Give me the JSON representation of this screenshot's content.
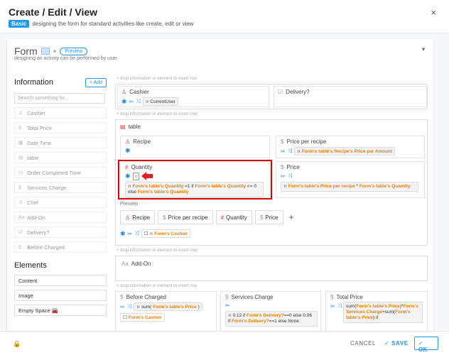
{
  "dialog": {
    "title": "Create / Edit / View",
    "badge": "Basic",
    "subtitle": "designing the form for standard activities like create, edit or view",
    "close_glyph": "×"
  },
  "form": {
    "title": "Form",
    "chip_close": "×",
    "preview_label": "Preview",
    "description": "designing an activity can be performed by user."
  },
  "sidebar": {
    "info_heading": "Information",
    "add_label": "+ Add",
    "search_placeholder": "Search something for...",
    "info_items": [
      {
        "icon": "user-icon",
        "glyph": "♙",
        "label": "Cashier"
      },
      {
        "icon": "dollar-icon",
        "glyph": "$",
        "label": "Total Price"
      },
      {
        "icon": "calendar-icon",
        "glyph": "▦",
        "label": "Date Time"
      },
      {
        "icon": "table-icon",
        "glyph": "▤",
        "label": "table"
      },
      {
        "icon": "clock-icon",
        "glyph": "◷",
        "label": "Order Completed Time"
      },
      {
        "icon": "dollar-icon",
        "glyph": "$",
        "label": "Services Charge"
      },
      {
        "icon": "user-icon",
        "glyph": "♙",
        "label": "Chef"
      },
      {
        "icon": "text-icon",
        "glyph": "Aa",
        "label": "Add-On"
      },
      {
        "icon": "checkbox-icon",
        "glyph": "☑",
        "label": "Delivery?"
      },
      {
        "icon": "dollar-icon",
        "glyph": "$",
        "label": "Before Charged"
      }
    ],
    "elements_heading": "Elements",
    "element_items": [
      "Content",
      "Image",
      "Empty Space 🚘"
    ]
  },
  "canvas": {
    "drop_hint": "+ drop information or element to insert row",
    "cashier": {
      "label": "Cashier",
      "chip": "CurrentUser"
    },
    "delivery": {
      "label": "Delivery?"
    },
    "table": {
      "label": "table"
    },
    "recipe": {
      "label": "Recipe"
    },
    "price_per_recipe": {
      "label": "Price per recipe",
      "ref": "Form's table's Recipe's Price per Amount"
    },
    "quantity": {
      "label": "Quantity",
      "formula_ref1": "Form's table's Quantity",
      "formula_mid1": " =1 if ",
      "formula_ref2": "Form's table's Quantity",
      "formula_mid2": " <= 0 else",
      "formula_ref3": "Form's table's Quantity"
    },
    "price": {
      "label": "Price",
      "ref1": "Form's table's Price per recipe",
      "op": " * ",
      "ref2": "Form's table's Quantity"
    },
    "preview": {
      "label": "Preview",
      "buttons": [
        "Recipe",
        "Price per recipe",
        "Quantity",
        "Price"
      ],
      "add": "+",
      "chip": "Form's Cashier"
    },
    "addon": {
      "label": "Add-On"
    },
    "before_charged": {
      "label": "Before Charged",
      "sum": "sum(",
      "ref": "Form's table's Price",
      "close": ")",
      "chip": "Form's Cashier"
    },
    "services_charge": {
      "label": "Services Charge",
      "pre": "0.12 if ",
      "ref1": "Form's Delivery?",
      "mid": "==0 else 0.06 if ",
      "ref2": "Form's Delivery?",
      "post": "==1 else None"
    },
    "total_price": {
      "label": "Total Price",
      "l1": "sum(",
      "ref1": "Form's table's Price",
      "l2": ")*",
      "ref2": "Form's Services Charge",
      "l3": "+sum(",
      "ref3": "Form's table's Price",
      "l4": ") if"
    }
  },
  "footer": {
    "cancel": "CANCEL",
    "save": "✓ SAVE",
    "ok": "✓ OK"
  },
  "colors": {
    "accent": "#2196f3",
    "reference": "#f57c00",
    "highlight": "#dd0000"
  }
}
